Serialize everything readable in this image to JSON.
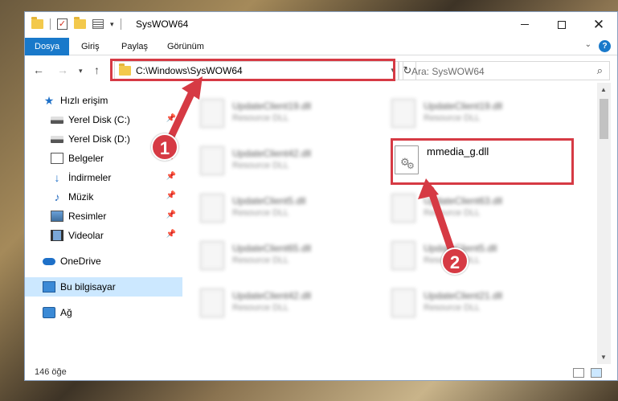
{
  "window": {
    "title": "SysWOW64"
  },
  "ribbon": {
    "tabs": [
      "Dosya",
      "Giriş",
      "Paylaş",
      "Görünüm"
    ],
    "help": "?"
  },
  "nav": {
    "path": "C:\\Windows\\SysWOW64",
    "search_placeholder": "Ara: SysWOW64"
  },
  "sidebar": {
    "items": [
      {
        "label": "Hızlı erişim",
        "icon": "star-icon"
      },
      {
        "label": "Yerel Disk (C:)",
        "icon": "drive-icon",
        "pinned": true
      },
      {
        "label": "Yerel Disk (D:)",
        "icon": "drive-icon",
        "pinned": true
      },
      {
        "label": "Belgeler",
        "icon": "documents-icon",
        "pinned": true
      },
      {
        "label": "İndirmeler",
        "icon": "downloads-icon",
        "pinned": true
      },
      {
        "label": "Müzik",
        "icon": "music-icon",
        "pinned": true
      },
      {
        "label": "Resimler",
        "icon": "pictures-icon",
        "pinned": true
      },
      {
        "label": "Videolar",
        "icon": "videos-icon",
        "pinned": true
      },
      {
        "label": "OneDrive",
        "icon": "onedrive-icon"
      },
      {
        "label": "Bu bilgisayar",
        "icon": "computer-icon",
        "selected": true
      },
      {
        "label": "Ağ",
        "icon": "network-icon"
      }
    ]
  },
  "files": [
    {
      "name": "UpdateClient19.dll",
      "type": "Resource DLL"
    },
    {
      "name": "UpdateClient19.dll",
      "type": "Resource DLL"
    },
    {
      "name": "UpdateClient42.dll",
      "type": "Resource DLL"
    },
    {
      "name": "mmedia_g.dll",
      "type": ""
    },
    {
      "name": "UpdateClient5.dll",
      "type": "Resource DLL"
    },
    {
      "name": "UpdateClient63.dll",
      "type": "Resource DLL"
    },
    {
      "name": "UpdateClient65.dll",
      "type": "Resource DLL"
    },
    {
      "name": "UpdateClient5.dll",
      "type": "Resource DLL"
    },
    {
      "name": "UpdateClient42.dll",
      "type": "Resource DLL"
    },
    {
      "name": "UpdateClient21.dll",
      "type": "Resource DLL"
    }
  ],
  "status": {
    "count": "146 öğe"
  },
  "callouts": {
    "one": "1",
    "two": "2"
  },
  "colors": {
    "accent": "#1979ca",
    "highlight": "#d63a44",
    "selected": "#cce8ff"
  }
}
